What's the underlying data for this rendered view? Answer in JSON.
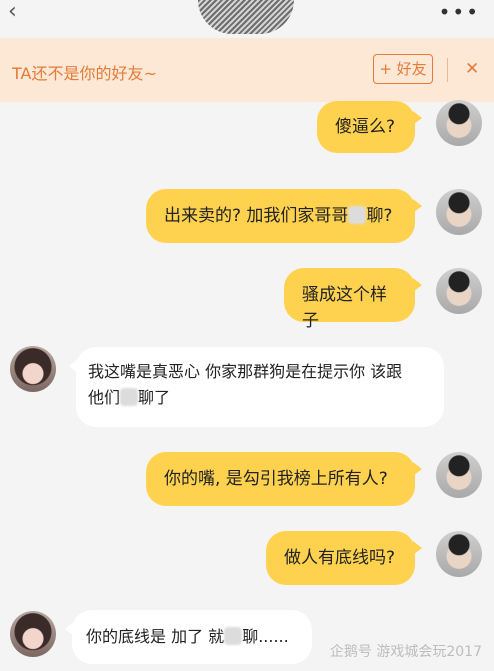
{
  "topbar": {
    "back_glyph": "‹",
    "more_glyph": "•••"
  },
  "banner": {
    "text": "TA还不是你的好友~",
    "add_button": "+ 好友",
    "close_glyph": "✕"
  },
  "messages": [
    {
      "from": "me",
      "text": "傻逼么?"
    },
    {
      "from": "me",
      "text_before": "出来卖的? 加我们家哥哥",
      "text_after": "聊?"
    },
    {
      "from": "me",
      "text": "骚成这个样子"
    },
    {
      "from": "her",
      "line1": "我这嘴是真恶心 你家那群狗是在提示你 该跟",
      "line2_before": "他们",
      "line2_after": "聊了"
    },
    {
      "from": "me",
      "text": "你的嘴, 是勾引我榜上所有人?"
    },
    {
      "from": "me",
      "text": "做人有底线吗?"
    },
    {
      "from": "her",
      "text_before": "你的底线是 加了 就",
      "text_after": "聊......"
    }
  ],
  "watermark": "企鹅号 游戏城会玩2017"
}
